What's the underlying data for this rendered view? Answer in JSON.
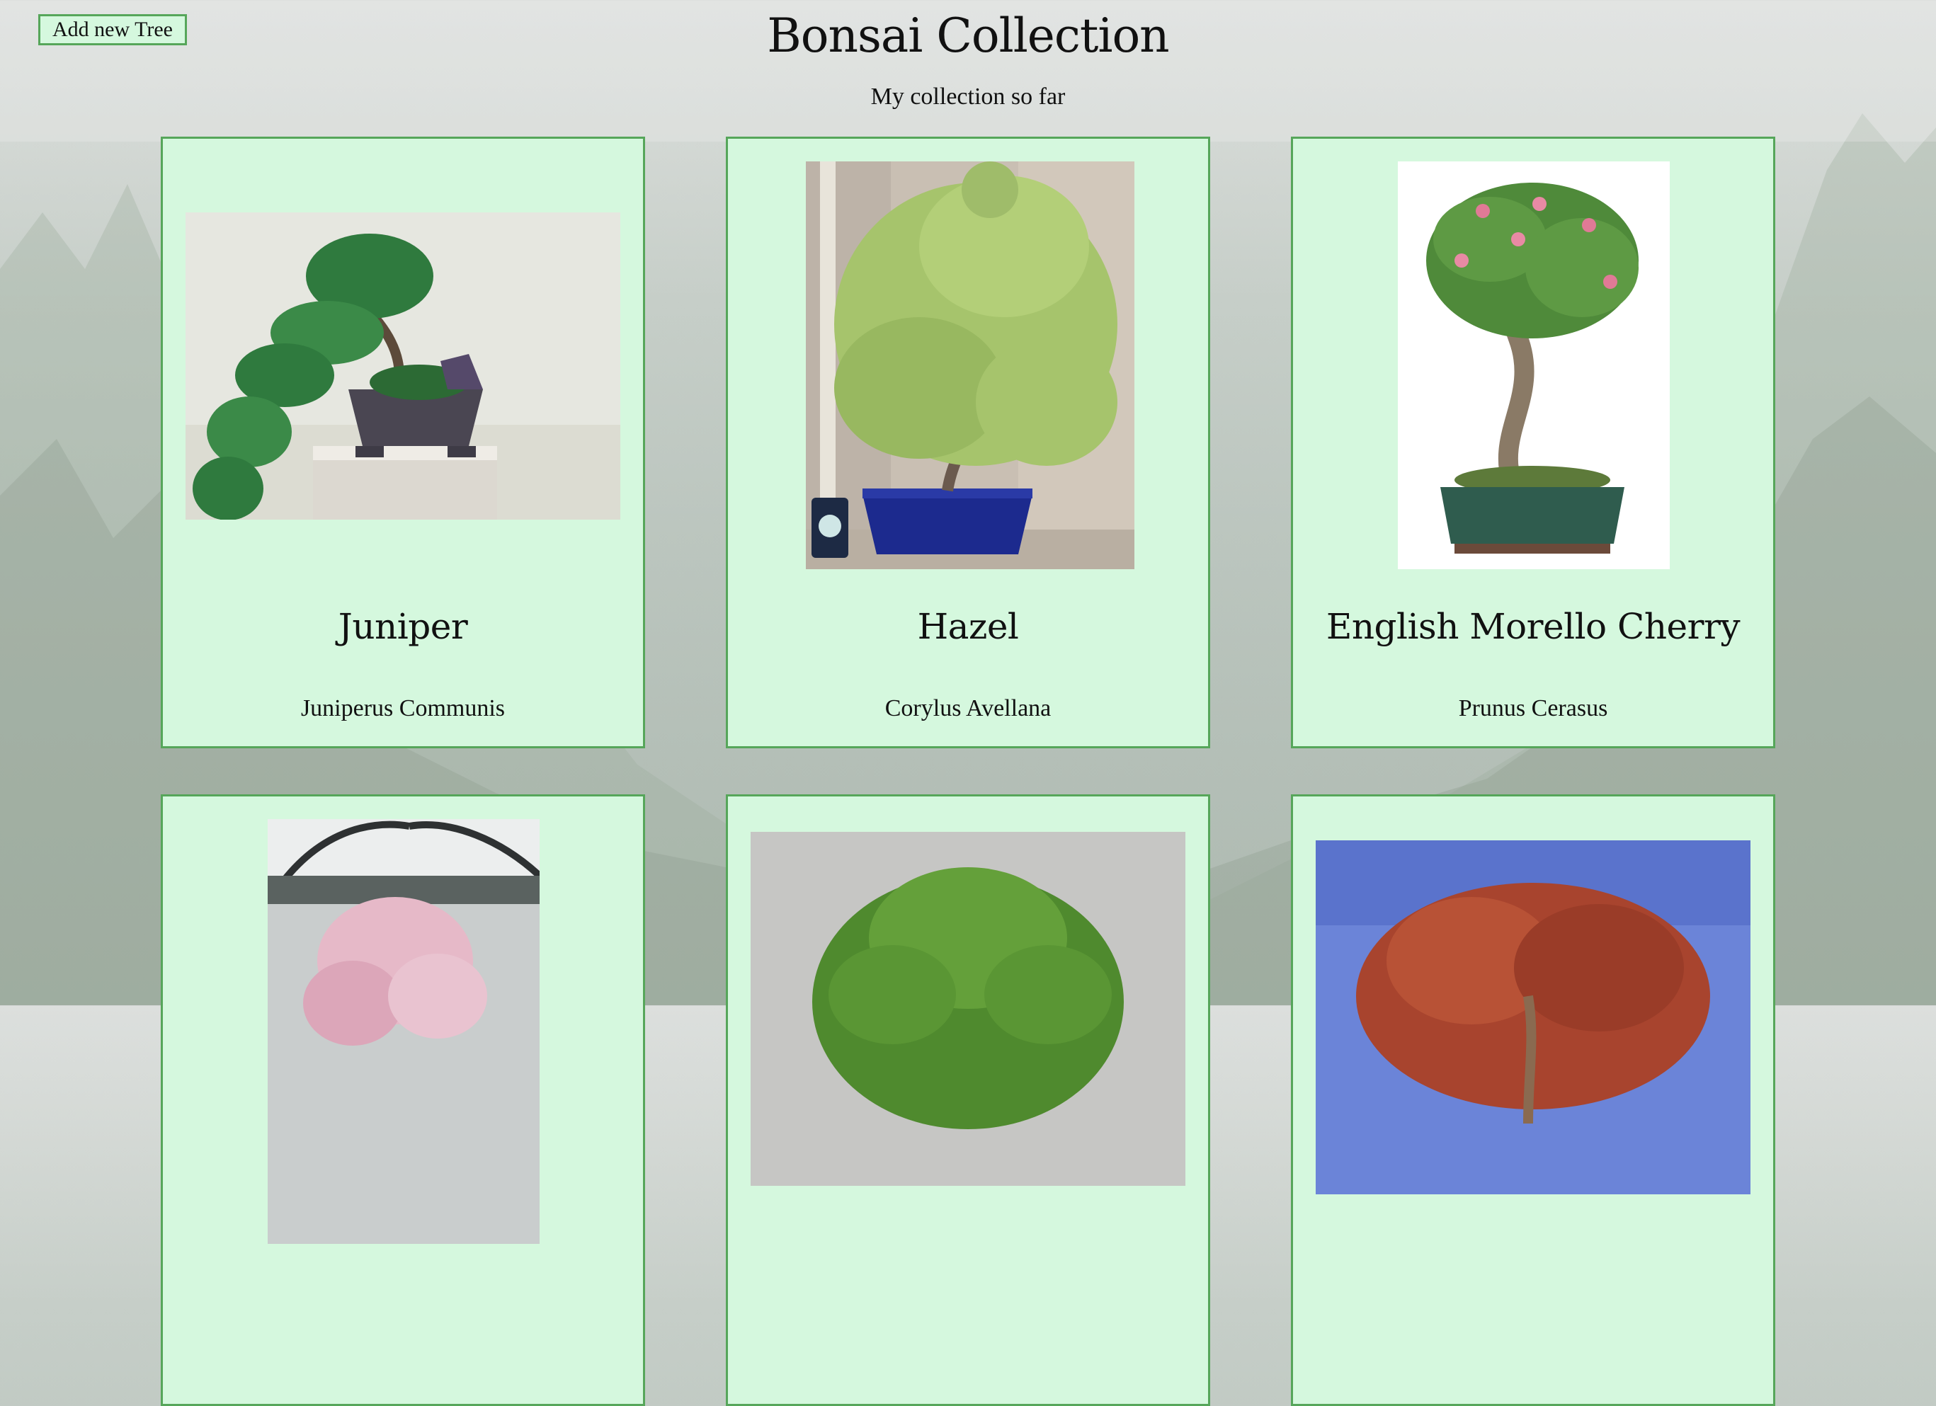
{
  "header": {
    "add_button_label": "Add new Tree",
    "title": "Bonsai Collection",
    "subtitle": "My collection so far"
  },
  "trees": [
    {
      "name": "Juniper",
      "latin": "Juniperus Communis",
      "photo": "juniper bonsai in grey pot"
    },
    {
      "name": "Hazel",
      "latin": "Corylus Avellana",
      "photo": "hazel bonsai in blue pot beside ruler"
    },
    {
      "name": "English Morello Cherry",
      "latin": "Prunus Cerasus",
      "photo": "flowering cherry bonsai in green pot"
    },
    {
      "name": "",
      "latin": "",
      "photo": "pink blossom bonsai"
    },
    {
      "name": "",
      "latin": "",
      "photo": "green dome bonsai"
    },
    {
      "name": "",
      "latin": "",
      "photo": "red leaf bonsai against blue sky"
    }
  ],
  "colors": {
    "card_background": "#d5f8de",
    "card_border": "#56a65a"
  }
}
